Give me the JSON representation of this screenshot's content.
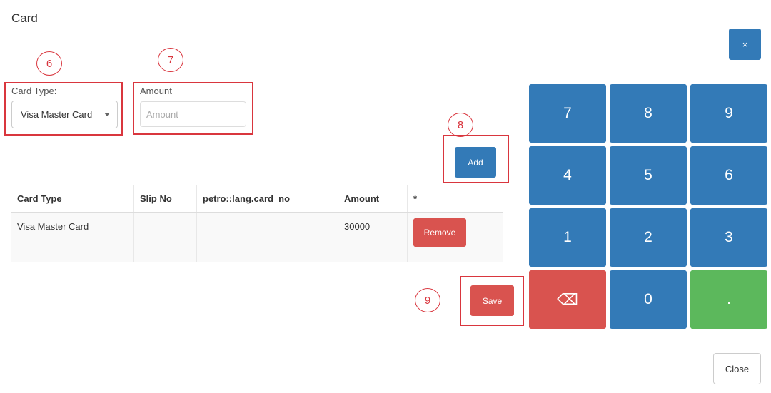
{
  "modal": {
    "title": "Card",
    "close_x": "×",
    "footer_close": "Close"
  },
  "annotations": {
    "n6": "6",
    "n7": "7",
    "n8": "8",
    "n9": "9"
  },
  "form": {
    "card_type_label": "Card Type:",
    "card_type_value": "Visa Master Card",
    "amount_label": "Amount",
    "amount_placeholder": "Amount",
    "add_label": "Add",
    "save_label": "Save"
  },
  "table": {
    "headers": [
      "Card Type",
      "Slip No",
      "petro::lang.card_no",
      "Amount",
      "*"
    ],
    "rows": [
      {
        "card_type": "Visa Master Card",
        "slip_no": "",
        "card_no": "",
        "amount": "30000",
        "action": "Remove"
      }
    ]
  },
  "keypad": {
    "k7": "7",
    "k8": "8",
    "k9": "9",
    "k4": "4",
    "k5": "5",
    "k6": "6",
    "k1": "1",
    "k2": "2",
    "k3": "3",
    "backspace": "⌫",
    "k0": "0",
    "dot": "."
  },
  "colors": {
    "primary": "#337ab7",
    "danger": "#d9534f",
    "success": "#5cb85c",
    "annotation": "#d9363e"
  }
}
